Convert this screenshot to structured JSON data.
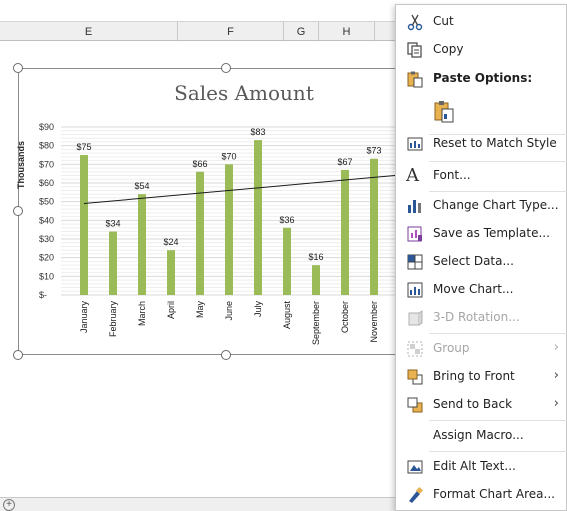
{
  "sheet": {
    "columns": [
      {
        "label": "E"
      },
      {
        "label": "F"
      },
      {
        "label": "G"
      },
      {
        "label": "H"
      }
    ]
  },
  "chart_data": {
    "type": "bar",
    "title": "Sales Amount",
    "ylabel": "Thousands",
    "categories": [
      "January",
      "February",
      "March",
      "April",
      "May",
      "June",
      "July",
      "August",
      "September",
      "October",
      "November"
    ],
    "values": [
      75,
      34,
      54,
      24,
      66,
      70,
      83,
      36,
      16,
      67,
      73
    ],
    "data_labels": [
      "$75",
      "$34",
      "$54",
      "$24",
      "$66",
      "$70",
      "$83",
      "$36",
      "$16",
      "$67",
      "$73"
    ],
    "y_ticks": [
      "$-",
      "$10",
      "$20",
      "$30",
      "$40",
      "$50",
      "$60",
      "$70",
      "$80",
      "$90"
    ],
    "ylim": [
      0,
      90
    ],
    "trendline": {
      "type": "linear",
      "start": 49,
      "end": 63
    },
    "bar_color": "#9bbb59",
    "grid": true
  },
  "menu": {
    "items": [
      {
        "label": "Cut",
        "icon": "scissors-icon"
      },
      {
        "label": "Copy",
        "icon": "copy-icon"
      },
      {
        "label": "Paste Options:",
        "icon": "paste-icon"
      },
      {
        "label": "",
        "icon": "paste-keep-formatting-icon"
      },
      {
        "label": "Reset to Match Style",
        "icon": "reset-style-icon"
      },
      {
        "label": "Font...",
        "icon": "font-icon"
      },
      {
        "label": "Change Chart Type...",
        "icon": "chart-type-icon"
      },
      {
        "label": "Save as Template...",
        "icon": "template-icon"
      },
      {
        "label": "Select Data...",
        "icon": "select-data-icon"
      },
      {
        "label": "Move Chart...",
        "icon": "move-chart-icon"
      },
      {
        "label": "3-D Rotation...",
        "icon": "rotation-3d-icon",
        "disabled": true
      },
      {
        "label": "Group",
        "icon": "group-icon",
        "disabled": true,
        "submenu": true
      },
      {
        "label": "Bring to Front",
        "icon": "bring-front-icon",
        "submenu": true
      },
      {
        "label": "Send to Back",
        "icon": "send-back-icon",
        "submenu": true
      },
      {
        "label": "Assign Macro...",
        "icon": ""
      },
      {
        "label": "Edit Alt Text...",
        "icon": "alt-text-icon"
      },
      {
        "label": "Format Chart Area...",
        "icon": "format-area-icon"
      }
    ],
    "submenu_glyph": "›"
  },
  "statusbar": {
    "add_sheet_glyph": "+"
  }
}
